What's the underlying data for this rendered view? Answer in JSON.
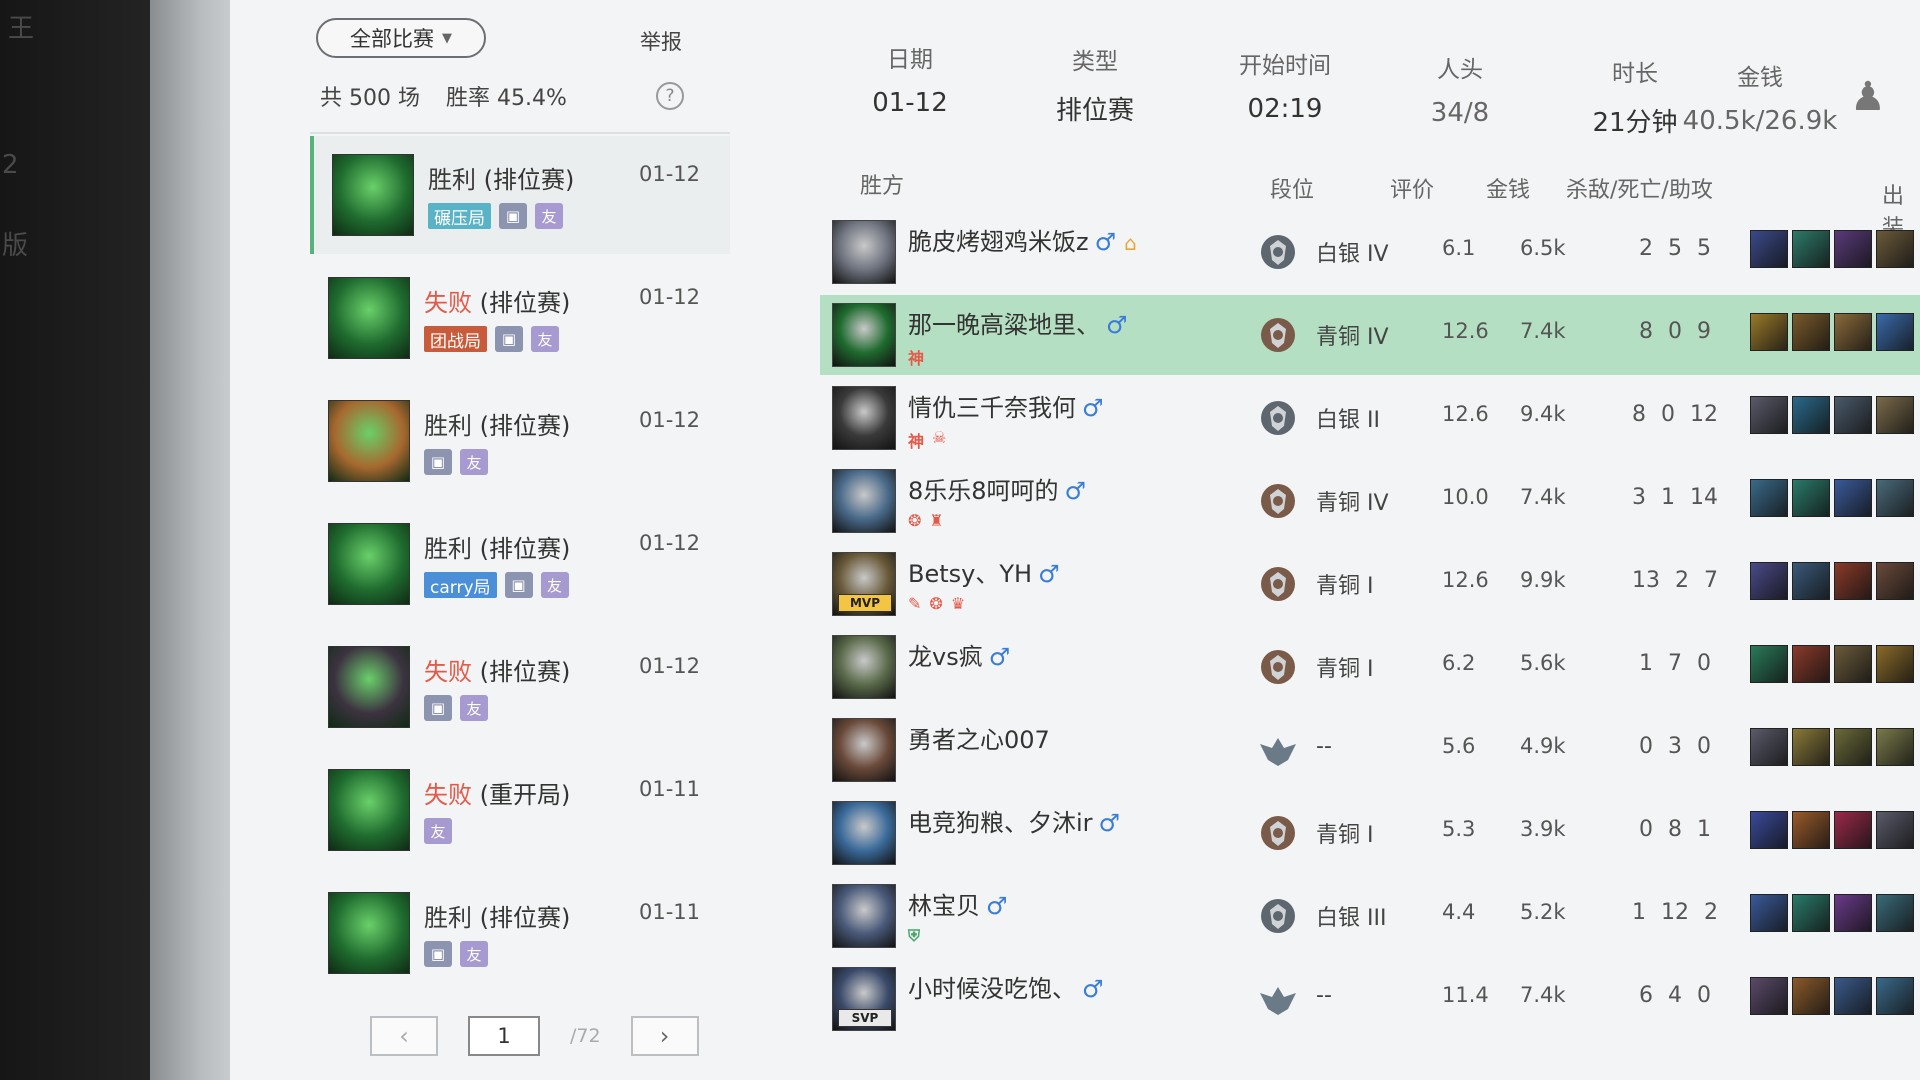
{
  "side": {
    "ghost_lines": [
      "王",
      "2",
      "版"
    ]
  },
  "list": {
    "filter_label": "全部比赛",
    "report_label": "举报",
    "total_label": "共 500 场",
    "winrate_label": "胜率 45.4%",
    "help_icon": "question-icon",
    "matches": [
      {
        "result": "胜利",
        "mode": "(排位赛)",
        "outcome": "win",
        "date": "01-12",
        "tag": "碾压局",
        "tag_color": "#58b3c7",
        "avatar_color": "#1f6b2f",
        "show_img": true
      },
      {
        "result": "失败",
        "mode": "(排位赛)",
        "outcome": "loss",
        "date": "01-12",
        "tag": "团战局",
        "tag_color": "#c75b3a",
        "avatar_color": "#1f6b2f",
        "show_img": true
      },
      {
        "result": "胜利",
        "mode": "(排位赛)",
        "outcome": "win",
        "date": "01-12",
        "tag": "",
        "tag_color": "",
        "avatar_color": "#a7682f",
        "show_img": true
      },
      {
        "result": "胜利",
        "mode": "(排位赛)",
        "outcome": "win",
        "date": "01-12",
        "tag": "carry局",
        "tag_color": "#4a8fd8",
        "avatar_color": "#1f6b2f",
        "show_img": true
      },
      {
        "result": "失败",
        "mode": "(排位赛)",
        "outcome": "loss",
        "date": "01-12",
        "tag": "",
        "tag_color": "",
        "avatar_color": "#3c3340",
        "show_img": true
      },
      {
        "result": "失败",
        "mode": "(重开局)",
        "outcome": "loss",
        "date": "01-11",
        "tag": "",
        "tag_color": "",
        "avatar_color": "#1f6b2f",
        "show_img": false
      },
      {
        "result": "胜利",
        "mode": "(排位赛)",
        "outcome": "win",
        "date": "01-11",
        "tag": "",
        "tag_color": "",
        "avatar_color": "#1f6b2f",
        "show_img": true
      }
    ],
    "img_tag_icon": "image-icon",
    "friend_tag": "友",
    "pager": {
      "prev": "‹",
      "page": "1",
      "total": "/72",
      "next": "›"
    }
  },
  "detail": {
    "stats": [
      {
        "label": "日期",
        "value": "01-12"
      },
      {
        "label": "类型",
        "value": "排位赛"
      },
      {
        "label": "开始时间",
        "value": "02:19"
      },
      {
        "label": "人头",
        "value": "34/8"
      },
      {
        "label": "时长",
        "value": "21分钟"
      },
      {
        "label": "金钱",
        "value": "40.5k/26.9k"
      }
    ],
    "team_icon": "team-icon",
    "columns": {
      "side": "胜方",
      "rank": "段位",
      "score": "评价",
      "gold": "金钱",
      "kda": "杀敌/死亡/助攻",
      "items": "出装"
    },
    "players": [
      {
        "name": "脆皮烤翅鸡米饭z",
        "gender": "♂",
        "extra": "⌂",
        "tags": [],
        "rank": "白银 IV",
        "rank_tier": "silver",
        "score": "6.1",
        "gold": "6.5k",
        "kda": "2 5 5",
        "badge": "",
        "avatar_color": "#6f7480",
        "me": false,
        "items": [
          "#3a4a8a",
          "#2e7a6a",
          "#5a3a7a",
          "#6a5a3a"
        ]
      },
      {
        "name": "那一晚高粱地里、",
        "gender": "♂",
        "extra": "",
        "tags": [
          "神"
        ],
        "rank": "青铜 IV",
        "rank_tier": "bronze",
        "score": "12.6",
        "gold": "7.4k",
        "kda": "8 0 9",
        "badge": "",
        "avatar_color": "#1f6b2f",
        "me": true,
        "items": [
          "#9a7a2a",
          "#7a5a2a",
          "#8a6a3a",
          "#3a6aaa"
        ]
      },
      {
        "name": "情仇三千奈我何",
        "gender": "♂",
        "extra": "",
        "tags": [
          "神",
          "☠"
        ],
        "rank": "白银 II",
        "rank_tier": "silver",
        "score": "12.6",
        "gold": "9.4k",
        "kda": "8 0 12",
        "badge": "",
        "avatar_color": "#3a3a3a",
        "me": false,
        "items": [
          "#5a5a6a",
          "#2a6a8a",
          "#4a5a6a",
          "#7a6a4a"
        ]
      },
      {
        "name": "8乐乐8呵呵的",
        "gender": "♂",
        "extra": "",
        "tags": [
          "❂",
          "♜"
        ],
        "rank": "青铜 IV",
        "rank_tier": "bronze",
        "score": "10.0",
        "gold": "7.4k",
        "kda": "3 1 14",
        "badge": "",
        "avatar_color": "#4a6a8a",
        "me": false,
        "items": [
          "#3a6a8a",
          "#2a7a6a",
          "#3a5a9a",
          "#4a6a7a"
        ]
      },
      {
        "name": "Betsy、YH",
        "gender": "♂",
        "extra": "",
        "tags": [
          "✎",
          "❂",
          "♛"
        ],
        "rank": "青铜 I",
        "rank_tier": "bronze",
        "score": "12.6",
        "gold": "9.9k",
        "kda": "13 2 7",
        "badge": "MVP",
        "avatar_color": "#6a5a3a",
        "me": false,
        "items": [
          "#4a4a8a",
          "#3a5a7a",
          "#8a3a2a",
          "#6a4a3a"
        ]
      },
      {
        "name": "龙vs疯",
        "gender": "♂",
        "extra": "",
        "tags": [],
        "rank": "青铜 I",
        "rank_tier": "bronze",
        "score": "6.2",
        "gold": "5.6k",
        "kda": "1 7 0",
        "badge": "",
        "avatar_color": "#5a6a4a",
        "me": false,
        "items": [
          "#2a7a5a",
          "#8a3a2a",
          "#6a5a3a",
          "#8a6a2a"
        ]
      },
      {
        "name": "勇者之心007",
        "gender": "",
        "extra": "",
        "tags": [],
        "rank": "--",
        "rank_tier": "none",
        "score": "5.6",
        "gold": "4.9k",
        "kda": "0 3 0",
        "badge": "",
        "avatar_color": "#6a4a3a",
        "me": false,
        "items": [
          "#5a5a6a",
          "#8a7a3a",
          "#6a6a3a",
          "#7a7a4a"
        ]
      },
      {
        "name": "电竞狗粮、夕沐ir",
        "gender": "♂",
        "extra": "",
        "tags": [],
        "rank": "青铜 I",
        "rank_tier": "bronze",
        "score": "5.3",
        "gold": "3.9k",
        "kda": "0 8 1",
        "badge": "",
        "avatar_color": "#3a6a9a",
        "me": false,
        "items": [
          "#3a4a9a",
          "#9a5a2a",
          "#9a2a4a",
          "#5a5a6a"
        ]
      },
      {
        "name": "林宝贝",
        "gender": "♂",
        "extra": "",
        "tags": [
          "⛨"
        ],
        "rank": "白银 III",
        "rank_tier": "silver",
        "score": "4.4",
        "gold": "5.2k",
        "kda": "1 12 2",
        "badge": "",
        "avatar_color": "#4a5a7a",
        "me": false,
        "items": [
          "#3a5a9a",
          "#2a7a6a",
          "#6a3a8a",
          "#3a6a7a"
        ]
      },
      {
        "name": "小时候没吃饱、",
        "gender": "♂",
        "extra": "",
        "tags": [],
        "rank": "--",
        "rank_tier": "none",
        "score": "11.4",
        "gold": "7.4k",
        "kda": "6 4 0",
        "badge": "SVP",
        "avatar_color": "#3a4a6a",
        "me": false,
        "items": [
          "#5a4a6a",
          "#8a5a2a",
          "#3a5a8a",
          "#3a6a8a"
        ]
      }
    ]
  }
}
